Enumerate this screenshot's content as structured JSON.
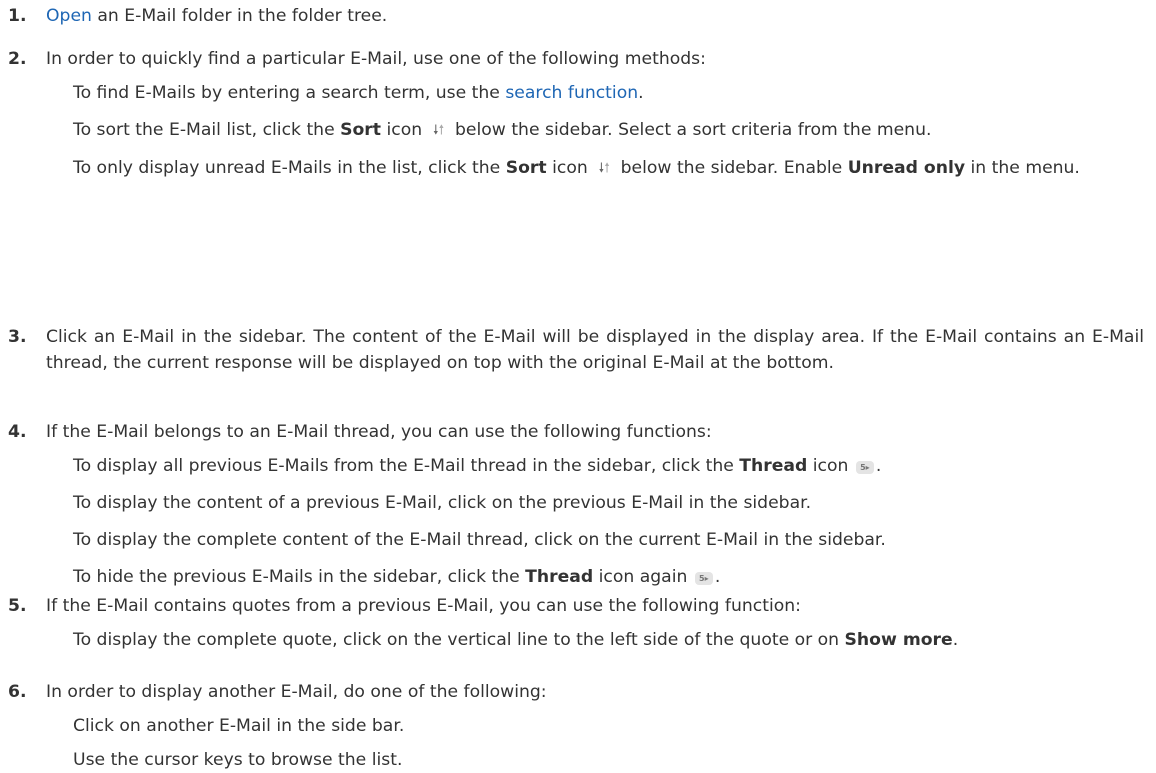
{
  "steps": [
    {
      "num": "1.",
      "link": "Open",
      "rest": " an E-Mail folder in the folder tree."
    },
    {
      "num": "2.",
      "text": "In order to quickly find a particular E-Mail, use one of the following methods:",
      "sub1_pre": "To find E-Mails by entering a search term, use the ",
      "sub1_link": "search function",
      "sub1_post": ".",
      "sub2_pre": "To sort the E-Mail list, click the ",
      "sub2_bold": "Sort",
      "sub2_mid": " icon ",
      "sub2_post": " below the sidebar. Select a sort criteria from the menu.",
      "sub3_pre": "To only display unread E-Mails in the list, click the ",
      "sub3_bold": "Sort",
      "sub3_mid": " icon ",
      "sub3_post": " below the sidebar. Enable ",
      "sub3_bold2": "Unread only",
      "sub3_end": " in the menu."
    },
    {
      "num": "3.",
      "text": "Click an E-Mail in the sidebar. The content of the E-Mail will be displayed in the display area. If the E-Mail contains an E-Mail thread, the current response will be displayed on top with the original E-Mail at the bottom."
    },
    {
      "num": "4.",
      "text": "If the E-Mail belongs to an E-Mail thread, you can use the following functions:",
      "sub1_pre": "To display all previous E-Mails from the E-Mail thread in the sidebar, click the ",
      "sub1_bold": "Thread",
      "sub1_post": " icon ",
      "sub1_end": ".",
      "sub2": "To display the content of a previous E-Mail, click on the previous E-Mail in the sidebar.",
      "sub3": "To display the complete content of the E-Mail thread, click on the current E-Mail in the sidebar.",
      "sub4_pre": "To hide the previous E-Mails in the sidebar, click the ",
      "sub4_bold": "Thread",
      "sub4_post": " icon again ",
      "sub4_end": "."
    },
    {
      "num": "5.",
      "text": "If the E-Mail contains quotes from a previous E-Mail, you can use the following function:",
      "sub1_pre": "To display the complete quote, click on the vertical line to the left side of the quote or on ",
      "sub1_bold": "Show more",
      "sub1_end": "."
    },
    {
      "num": "6.",
      "text": "In order to display another E-Mail, do one of the following:",
      "sub1": "Click on another E-Mail in the side bar.",
      "sub2": "Use the cursor keys to browse the list."
    }
  ],
  "icons": {
    "sort_down": "🠗",
    "sort_up": "🠕",
    "thread_badge": "5▸"
  },
  "colors": {
    "link": "#1e66b4",
    "text": "#333333",
    "icon_bg": "#e4e4e4"
  }
}
